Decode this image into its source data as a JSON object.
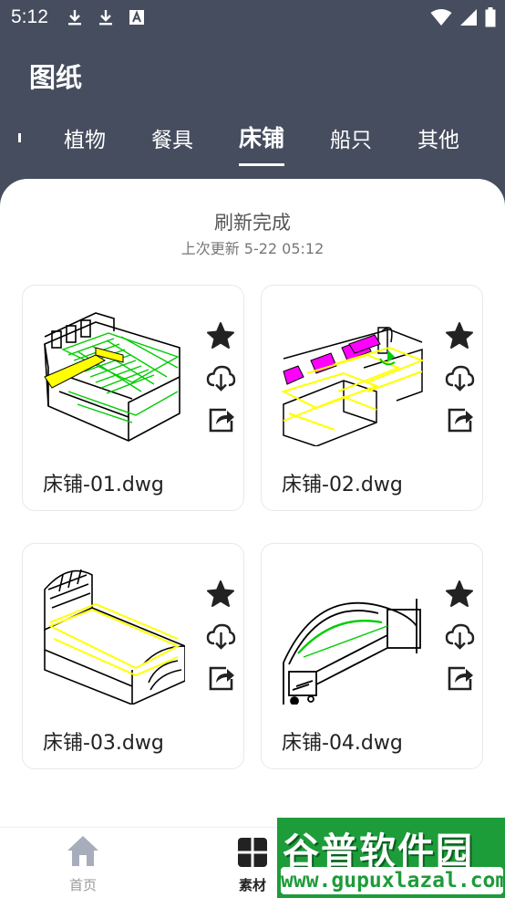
{
  "status_bar": {
    "time": "5:12",
    "left_icons": [
      "download-icon",
      "download-icon",
      "font-a-icon"
    ],
    "right_icons": [
      "wifi-icon",
      "signal-icon",
      "battery-icon"
    ]
  },
  "header": {
    "title": "图纸"
  },
  "tabs": [
    {
      "label": "植物",
      "active": false
    },
    {
      "label": "餐具",
      "active": false
    },
    {
      "label": "床铺",
      "active": true
    },
    {
      "label": "船只",
      "active": false
    },
    {
      "label": "其他",
      "active": false
    }
  ],
  "refresh": {
    "title": "刷新完成",
    "subtitle": "上次更新 5-22 05:12"
  },
  "cards": [
    {
      "filename": "床铺-01.dwg",
      "actions": [
        "star-icon",
        "cloud-download-icon",
        "share-icon"
      ]
    },
    {
      "filename": "床铺-02.dwg",
      "actions": [
        "star-icon",
        "cloud-download-icon",
        "share-icon"
      ]
    },
    {
      "filename": "床铺-03.dwg",
      "actions": [
        "star-icon",
        "cloud-download-icon",
        "share-icon"
      ]
    },
    {
      "filename": "床铺-04.dwg",
      "actions": [
        "star-icon",
        "cloud-download-icon",
        "share-icon"
      ]
    }
  ],
  "bottom_nav": [
    {
      "label": "首页",
      "icon": "home-icon",
      "active": false
    },
    {
      "label": "素材",
      "icon": "material-icon",
      "active": true
    }
  ],
  "watermark": {
    "title": "谷普软件园",
    "url": "www.gupuxlazal.com"
  },
  "colors": {
    "header_bg": "#454d5e",
    "sheet_bg": "#ffffff",
    "cad_green": "#00cc00",
    "cad_yellow": "#ffff00",
    "cad_magenta": "#ff00ff",
    "watermark_green": "#1d9c3a"
  }
}
